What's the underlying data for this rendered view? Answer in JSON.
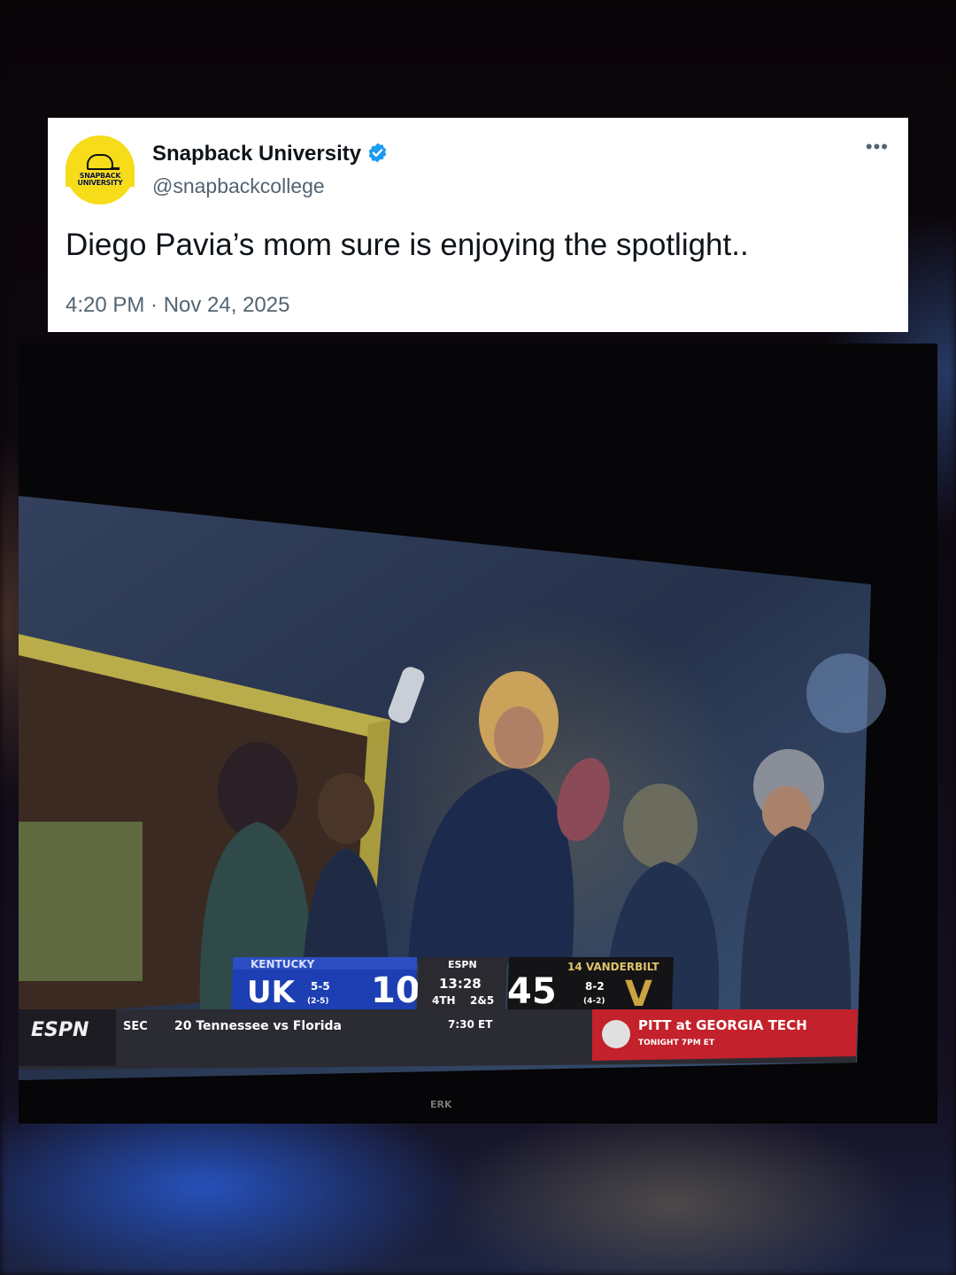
{
  "tweet": {
    "display_name": "Snapback University",
    "handle": "@snapbackcollege",
    "text": "Diego Pavia’s mom sure is enjoying the spotlight..",
    "timestamp": "4:20 PM · Nov 24, 2025",
    "avatar_text": "SNAPBACK UNIVERSITY",
    "more_icon": "more-options-icon",
    "verified_color": "#1d9bf0",
    "avatar_color": "#f6dc19"
  },
  "scorebug": {
    "network": "ESPN",
    "away_team": "KENTUCKY",
    "away_abbr": "UK",
    "away_record": "5-5",
    "away_conf_record": "(2-5)",
    "away_score": "10",
    "clock": "13:28",
    "quarter": "4TH",
    "down": "2&5",
    "home_score": "45",
    "home_team": "14 VANDERBILT",
    "home_record": "8-2",
    "home_conf_record": "(4-2)",
    "home_abbr": "V",
    "ticker_league": "SEC",
    "ticker_game": "20 Tennessee vs Florida",
    "ticker_time": "7:30 ET",
    "promo_game": "PITT at GEORGIA TECH",
    "promo_time": "TONIGHT 7PM ET",
    "corner": "ESPN"
  }
}
